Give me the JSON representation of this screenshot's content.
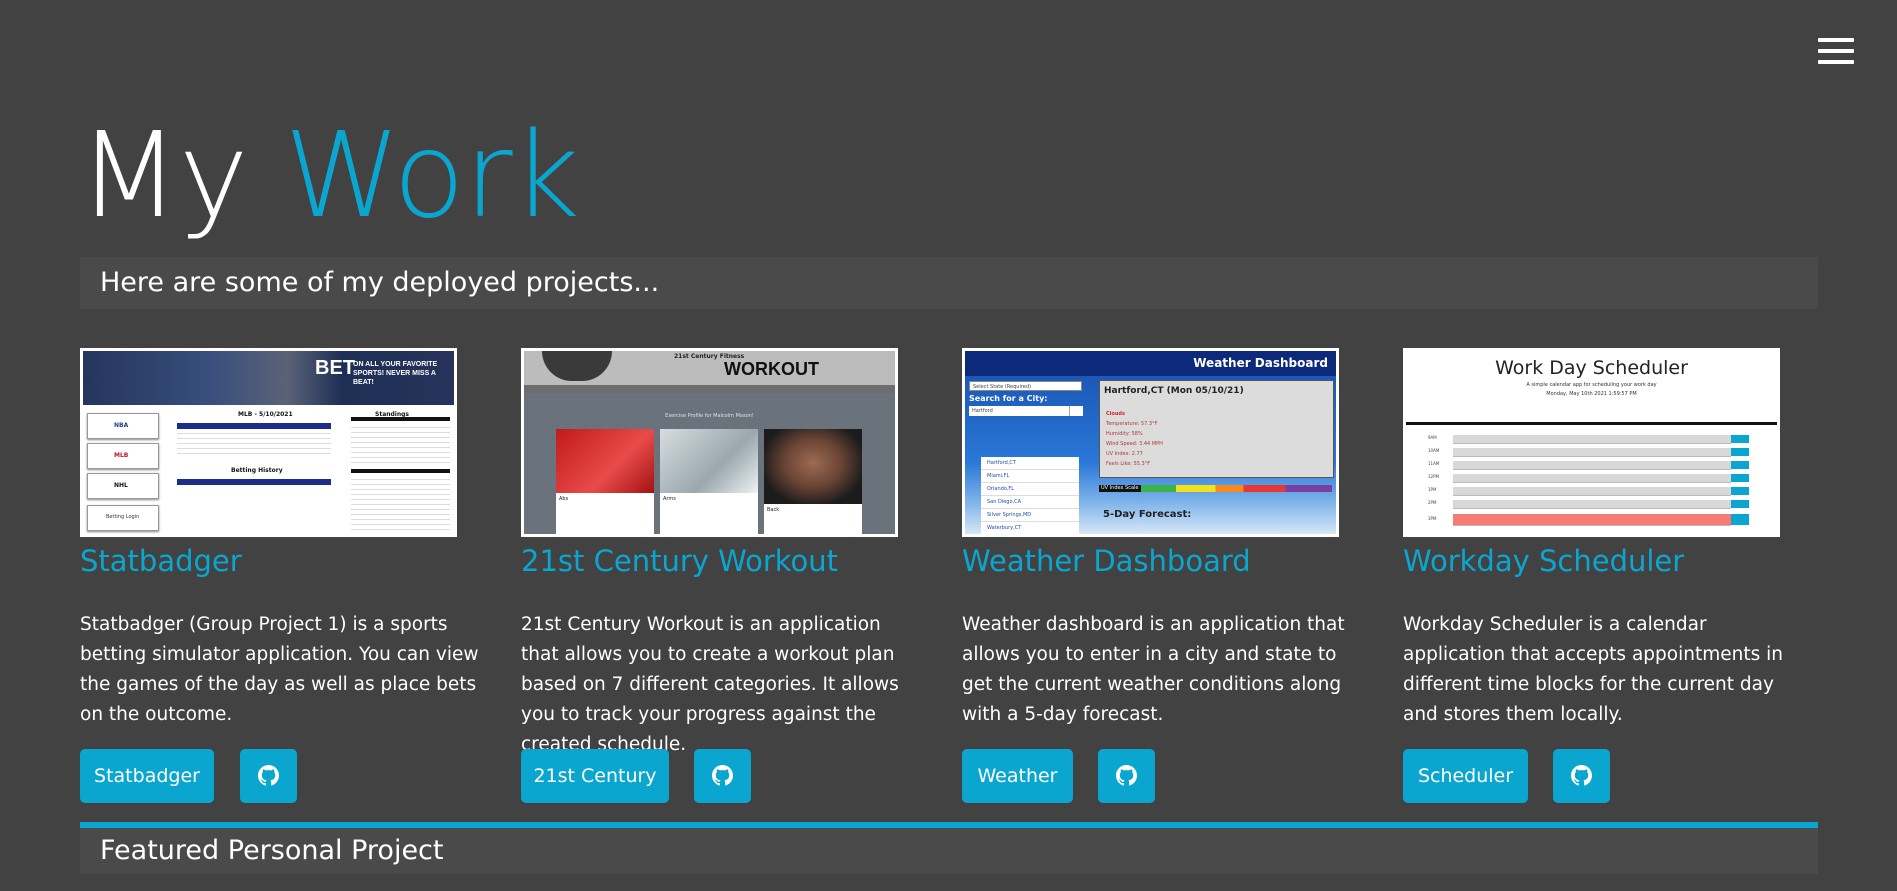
{
  "header": {
    "title_main": "My",
    "title_accent": "Work",
    "menu_icon": "hamburger-menu-icon"
  },
  "intro": {
    "text": "Here are some of my deployed projects..."
  },
  "projects": [
    {
      "title": "Statbadger",
      "description": "Statbadger (Group Project 1) is a sports betting simulator application. You can view the games of the day as well as place bets on the outcome.",
      "button_label": "Statbadger",
      "github_icon": "github-icon",
      "thumbnail": {
        "banner_big": "BET",
        "banner_text": "ON ALL YOUR FAVORITE SPORTS! NEVER MISS A BEAT!",
        "heading": "MLB - 5/10/2021",
        "standings": "Standings",
        "history": "Betting History",
        "side_labels": [
          "NBA",
          "MLB",
          "NHL",
          "Betting Login"
        ]
      }
    },
    {
      "title": "21st Century Workout",
      "description": "21st Century Workout is an application that allows you to create a workout plan based on 7 different categories. It allows you to track your progress against the created schedule.",
      "button_label": "21st Century",
      "github_icon": "github-icon",
      "thumbnail": {
        "brand": "21st Century Fitness",
        "heading": "WORKOUT",
        "profile": "Exercise Profile for Malcolm Mason!",
        "cards": [
          "Abs",
          "Arms",
          "Back"
        ]
      }
    },
    {
      "title": "Weather Dashboard",
      "description": "Weather dashboard is an application that allows you to enter in a city and state to get the current weather conditions along with a 5-day forecast.",
      "button_label": "Weather",
      "github_icon": "github-icon",
      "thumbnail": {
        "heading": "Weather Dashboard",
        "select_placeholder": "Select State (Required)",
        "search_label": "Search for a City:",
        "search_value": "Hartford",
        "city_heading": "Hartford,CT (Mon 05/10/21)",
        "conditions": [
          "Clouds",
          "Temperature: 57.3°F",
          "Humidity: 58%",
          "Wind Speed: 3.44 MPH",
          "UV Index: 2.77",
          "Feels Like: 55.3°F"
        ],
        "history": [
          "Hartford,CT",
          "Miami,FL",
          "Orlando,FL",
          "San Diego,CA",
          "Silver Springs,MD",
          "Waterbury,CT"
        ],
        "uv_scale_label": "UV Index Scale",
        "forecast_label": "5-Day Forecast:"
      }
    },
    {
      "title": "Workday Scheduler",
      "description": "Workday Scheduler is a calendar application that accepts appointments in different time blocks for the current day and stores them locally.",
      "button_label": "Scheduler",
      "github_icon": "github-icon",
      "thumbnail": {
        "heading": "Work Day Scheduler",
        "subheading": "A simple calendar app for scheduling your work day",
        "date": "Monday, May 10th 2021 1:59:57 PM",
        "hours": [
          "9AM",
          "10AM",
          "11AM",
          "12PM",
          "1PM",
          "2PM",
          "3PM"
        ]
      }
    }
  ],
  "featured": {
    "text": "Featured Personal Project"
  },
  "colors": {
    "background": "#424242",
    "accent": "#0aa6d0",
    "banner": "#4a4a4a",
    "text": "#ffffff"
  }
}
